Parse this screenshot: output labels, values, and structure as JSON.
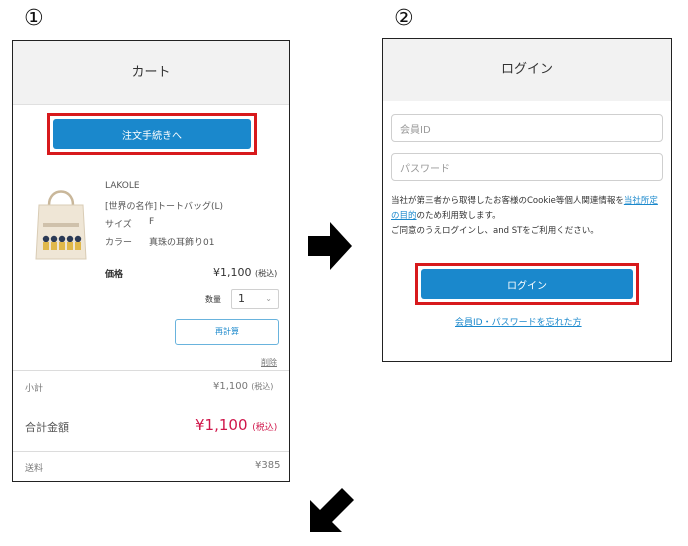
{
  "step1": {
    "number": "①",
    "header_title": "カート",
    "checkout_button": "注文手続きへ",
    "product": {
      "brand": "LAKOLE",
      "name": "[世界の名作]トートバッグ(L)",
      "size_label": "サイズ",
      "size_value": "F",
      "color_label": "カラー",
      "color_value": "真珠の耳飾り01",
      "price_label": "価格",
      "price_value": "¥1,100",
      "price_tax": "(税込)",
      "qty_label": "数量",
      "qty_value": "1",
      "recalc_button": "再計算",
      "delete_link": "削除"
    },
    "subtotal_label": "小計",
    "subtotal_value": "¥1,100",
    "subtotal_tax": "(税込)",
    "total_label": "合計金額",
    "total_value": "¥1,100",
    "total_tax": "(税込)",
    "shipping_label": "送料",
    "shipping_value": "¥385"
  },
  "step2": {
    "number": "②",
    "header_title": "ログイン",
    "member_id_placeholder": "会員ID",
    "password_placeholder": "パスワード",
    "notice_part1": "当社が第三者から取得したお客様のCookie等個人関連情報を",
    "notice_link": "当社所定の目的",
    "notice_part2": "のため利用致します。",
    "notice_line2": "ご同意のうえログインし、and STをご利用ください。",
    "login_button": "ログイン",
    "forgot_link": "会員ID・パスワードを忘れた方"
  },
  "colors": {
    "accent": "#1a88cc",
    "highlight_frame": "#d7191c",
    "total_price": "#d0164a"
  },
  "icons": [
    "arrow-right-icon",
    "arrow-down-left-icon",
    "chevron-down-icon"
  ]
}
